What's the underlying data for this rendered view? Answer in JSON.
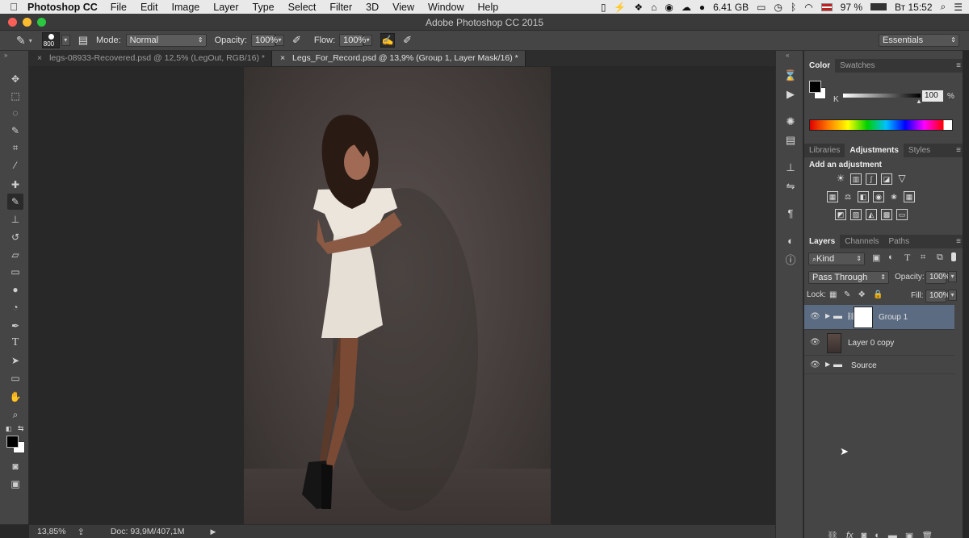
{
  "menubar": {
    "apple": "",
    "app_name": "Photoshop CC",
    "items": [
      "File",
      "Edit",
      "Image",
      "Layer",
      "Type",
      "Select",
      "Filter",
      "3D",
      "View",
      "Window",
      "Help"
    ],
    "memory": "6.41 GB",
    "battery": "97 %",
    "clock": "Вт 15:52"
  },
  "titlebar": {
    "title": "Adobe Photoshop CC 2015"
  },
  "options": {
    "brush_size": "800",
    "mode_label": "Mode:",
    "mode_value": "Normal",
    "opacity_label": "Opacity:",
    "opacity_value": "100%",
    "flow_label": "Flow:",
    "flow_value": "100%",
    "workspace": "Essentials"
  },
  "tabs": [
    {
      "label": "legs-08933-Recovered.psd @ 12,5% (LegOut, RGB/16) *",
      "active": false
    },
    {
      "label": "Legs_For_Record.psd @ 13,9% (Group 1, Layer Mask/16) *",
      "active": true
    }
  ],
  "status": {
    "zoom": "13,85%",
    "doc": "Doc: 93,9M/407,1M"
  },
  "color_panel": {
    "tabs": [
      "Color",
      "Swatches"
    ],
    "channel": "K",
    "value": "100",
    "unit": "%"
  },
  "adjustments_panel": {
    "tabs": [
      "Libraries",
      "Adjustments",
      "Styles"
    ],
    "heading": "Add an adjustment"
  },
  "layers_panel": {
    "tabs": [
      "Layers",
      "Channels",
      "Paths"
    ],
    "kind": "Kind",
    "blend_mode": "Pass Through",
    "opacity_label": "Opacity:",
    "opacity_value": "100%",
    "lock_label": "Lock:",
    "fill_label": "Fill:",
    "fill_value": "100%",
    "layers": [
      {
        "name": "Group 1",
        "selected": true
      },
      {
        "name": "Layer 0 copy",
        "selected": false
      },
      {
        "name": "Source",
        "selected": false
      }
    ]
  },
  "colors": {
    "menubar_bg": "#e9e9e9",
    "panel_bg": "#454545",
    "canvas_bg": "#282828",
    "selection": "#5a6b82",
    "close": "#fc5f57",
    "minimize": "#fdbc2e",
    "zoom": "#2bc840"
  }
}
